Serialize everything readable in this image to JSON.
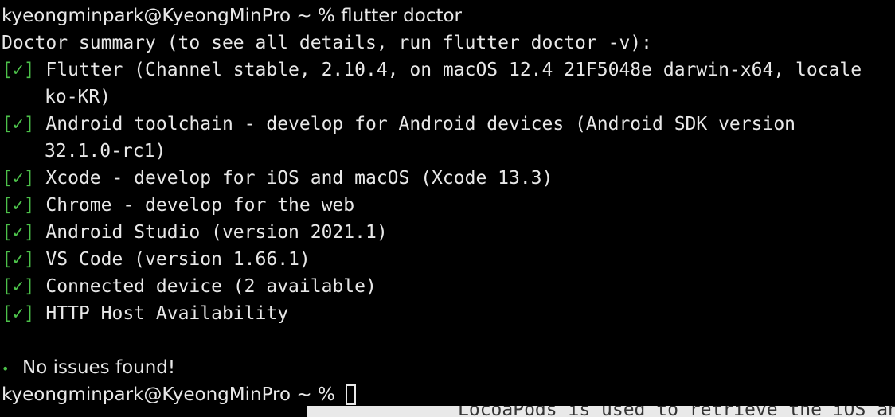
{
  "terminal": {
    "prompt_line_1": "kyeongminpark@KyeongMinPro ~ % flutter doctor",
    "summary_line": "Doctor summary (to see all details, run flutter doctor -v):",
    "check_mark": "[✓]",
    "checks": [
      {
        "text": "Flutter (Channel stable, 2.10.4, on macOS 12.4 21F5048e darwin-x64, locale",
        "continuation": "ko-KR)"
      },
      {
        "text": "Android toolchain - develop for Android devices (Android SDK version",
        "continuation": "32.1.0-rc1)"
      },
      {
        "text": "Xcode - develop for iOS and macOS (Xcode 13.3)"
      },
      {
        "text": "Chrome - develop for the web"
      },
      {
        "text": "Android Studio (version 2021.1)"
      },
      {
        "text": "VS Code (version 1.66.1)"
      },
      {
        "text": "Connected device (2 available)"
      },
      {
        "text": "HTTP Host Availability"
      }
    ],
    "result_bullet": "•",
    "result_text": "No issues found!",
    "prompt_line_2": "kyeongminpark@KyeongMinPro ~ % "
  },
  "background_window": {
    "text": "LocoaPods is used to retrieve the iOS an"
  },
  "colors": {
    "background": "#000000",
    "text": "#e8e8e8",
    "check_green": "#4cc14a"
  }
}
